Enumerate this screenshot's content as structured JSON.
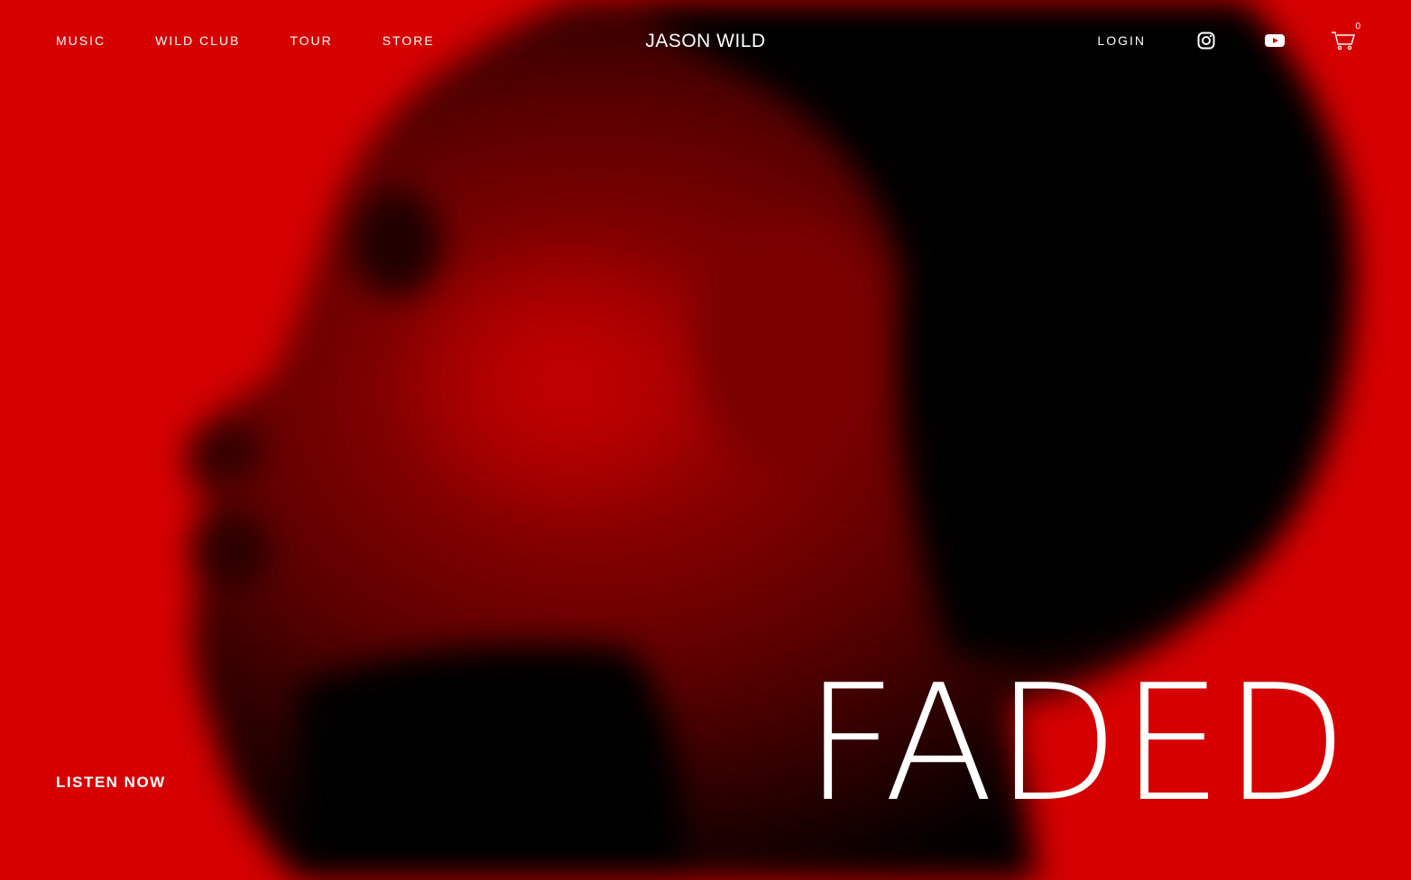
{
  "nav": {
    "items": [
      {
        "label": "MUSIC"
      },
      {
        "label": "WILD CLUB"
      },
      {
        "label": "TOUR"
      },
      {
        "label": "STORE"
      }
    ],
    "brand": "JASON WILD",
    "login": "LOGIN",
    "icons": {
      "instagram": "instagram-icon",
      "youtube": "youtube-icon",
      "cart": "cart-icon"
    },
    "cart_count": "0"
  },
  "hero": {
    "title": "FADED",
    "cta": "LISTEN NOW"
  },
  "colors": {
    "background": "#d60000",
    "text": "#ffffff",
    "shadow": "#000000"
  }
}
